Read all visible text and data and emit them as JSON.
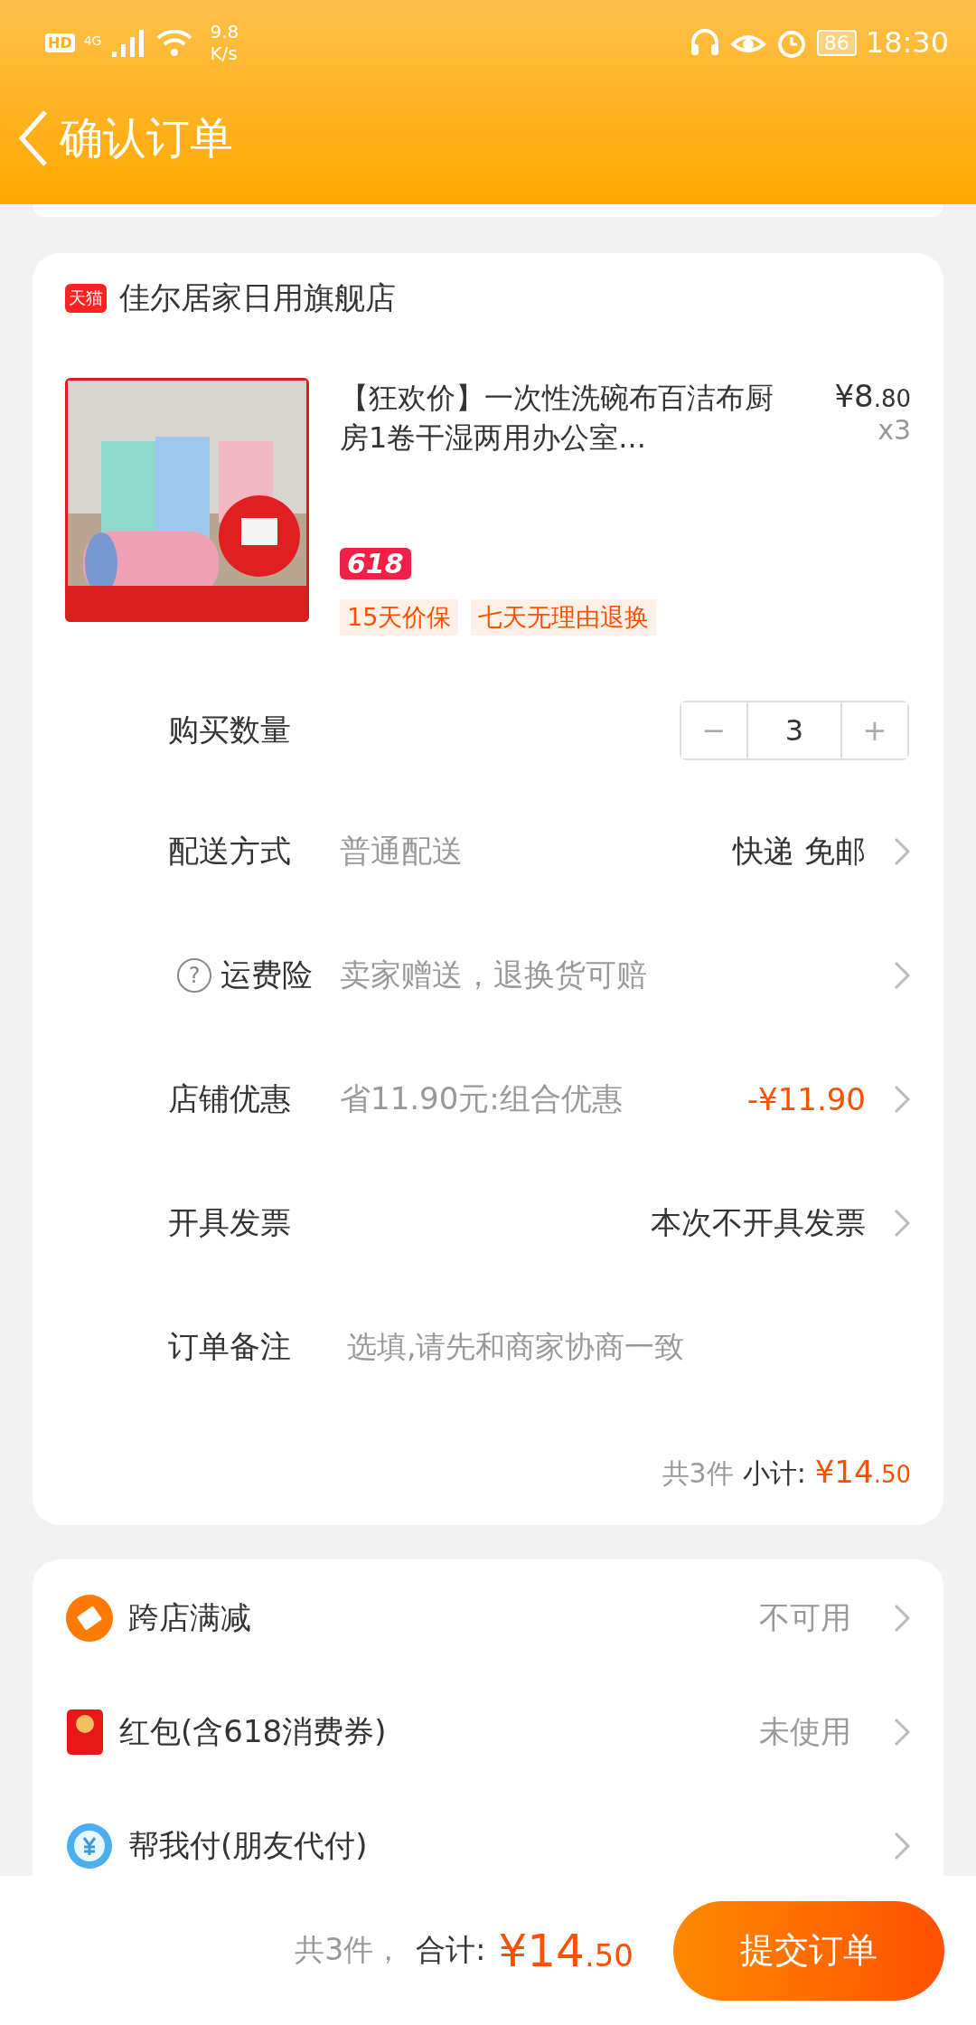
{
  "status_bar": {
    "hd": "HD",
    "network": "4G",
    "speed_value": "9.8",
    "speed_unit": "K/s",
    "battery": "86",
    "time": "18:30"
  },
  "header": {
    "title": "确认订单"
  },
  "store": {
    "badge": "天猫",
    "name": "佳尔居家日用旗舰店",
    "product": {
      "image": {
        "kind": "picture"
      },
      "title": "【狂欢价】一次性洗碗布百洁布厨房1卷干湿两用办公室...",
      "price_main": "¥8",
      "price_decimal": ".80",
      "quantity": "x3",
      "promo_badge": "618",
      "tags": [
        "15天价保",
        "七天无理由退换"
      ]
    },
    "rows": [
      {
        "kind": "stepper",
        "label": "购买数量",
        "minus": "−",
        "value": "3",
        "plus": "+"
      },
      {
        "kind": "option",
        "label": "配送方式",
        "hint": "普通配送",
        "value": "快递 免邮",
        "highlighted": false
      },
      {
        "kind": "option",
        "label": "运费险",
        "help": "?",
        "hint": "卖家赠送，退换货可赔"
      },
      {
        "kind": "option",
        "label": "店铺优惠",
        "hint": "省11.90元:组合优惠",
        "value": "-¥11.90",
        "highlighted": true
      },
      {
        "kind": "option",
        "label": "开具发票",
        "value": "本次不开具发票",
        "highlighted": false
      },
      {
        "kind": "note",
        "label": "订单备注",
        "placeholder": "选填,请先和商家协商一致"
      }
    ],
    "summary": {
      "count": "共3件",
      "label": "小计:",
      "price_main": "¥14",
      "price_decimal": ".50"
    }
  },
  "benefits": [
    {
      "label": "跨店满减",
      "value": "不可用"
    },
    {
      "label": "红包(含618消费券)",
      "value": "未使用"
    },
    {
      "label": "帮我付(朋友代付)"
    }
  ],
  "footer": {
    "count": "共3件，",
    "label": "合计:",
    "price_main": "¥14",
    "price_decimal": ".50",
    "submit": "提交订单"
  }
}
